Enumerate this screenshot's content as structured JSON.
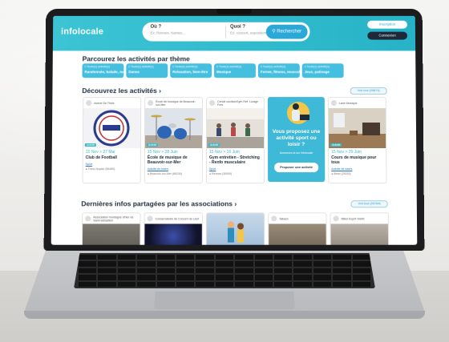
{
  "header": {
    "logo": "infolocale",
    "where_label": "Où ?",
    "where_placeholder": "Ex: Rennes, Nantes...",
    "what_label": "Quoi ?",
    "what_placeholder": "Ex: concert, exposition, danse...",
    "search_button": "Rechercher",
    "btn_register": "Inscription",
    "btn_login": "Connexion"
  },
  "themes_section": {
    "title": "Parcourez les activités par thème",
    "items": [
      {
        "count": "0 Toute(s) activité(s)",
        "label": "Randonnée, balade, marche"
      },
      {
        "count": "0 Toute(s) activité(s)",
        "label": "Danse"
      },
      {
        "count": "0 Toute(s) activité(s)",
        "label": "Relaxation, bien-être"
      },
      {
        "count": "0 Toute(s) activité(s)",
        "label": "Musique"
      },
      {
        "count": "0 Toute(s) activité(s)",
        "label": "Forme, fitness, musculation"
      },
      {
        "count": "0 Toute(s) activité(s)",
        "label": "Jeux, patinage"
      }
    ]
  },
  "activities_section": {
    "title": "Découvrez les activités",
    "see_all": "Voir tout (05873)",
    "cards": [
      {
        "org": "Avenir De Theix",
        "tag": "Activité",
        "date": "15 Nov > 27 Mai",
        "title": "Club de Football",
        "link": "Sport",
        "loc": "Theix-Noyalo (56450)"
      },
      {
        "org": "École de musique de Beauvoir-sur-Mer",
        "tag": "Activité",
        "date": "15 Nov > 28 Juin",
        "title": "École de musique de Beauvoir-sur-Mer",
        "link": "Activité de loisirs",
        "loc": "Beauvoir-sur-Mer (85230)"
      },
      {
        "org": "Cercle occitan/Gym Ref. Lorage Fres",
        "tag": "Activité",
        "date": "15 Nov > 16 Juin",
        "title": "Gym entretien - Stretching - Renfo musculaire",
        "link": "Sport",
        "loc": "Rennes (35000)"
      },
      {
        "org": "Lane Musique",
        "tag": "Activité",
        "date": "15 Nov > 29 Juin",
        "title": "Cours de musique pour tous",
        "link": "Activité de loisirs",
        "loc": "Brest (29200)"
      }
    ],
    "promo": {
      "title": "Vous proposez une activité sport ou loisir ?",
      "subtitle": "Annoncez-la sur Infolocale",
      "button": "Proposer une activité"
    }
  },
  "news_section": {
    "title": "Dernières infos partagées par les associations",
    "see_all": "Voir tout (05784)",
    "cards": [
      {
        "org": "Association montagne d'hier de Saint-sébastien"
      },
      {
        "org": "Conservatoire de Concert de Liszt"
      },
      {
        "org": ""
      },
      {
        "org": "Tabacs"
      },
      {
        "org": "Mikel Esprit Viétbt"
      }
    ]
  },
  "colors": {
    "brand": "#27b3c7",
    "theme_tile": "#45bfe0",
    "promo": "#3fb9d8",
    "dark": "#1d2b3a"
  }
}
